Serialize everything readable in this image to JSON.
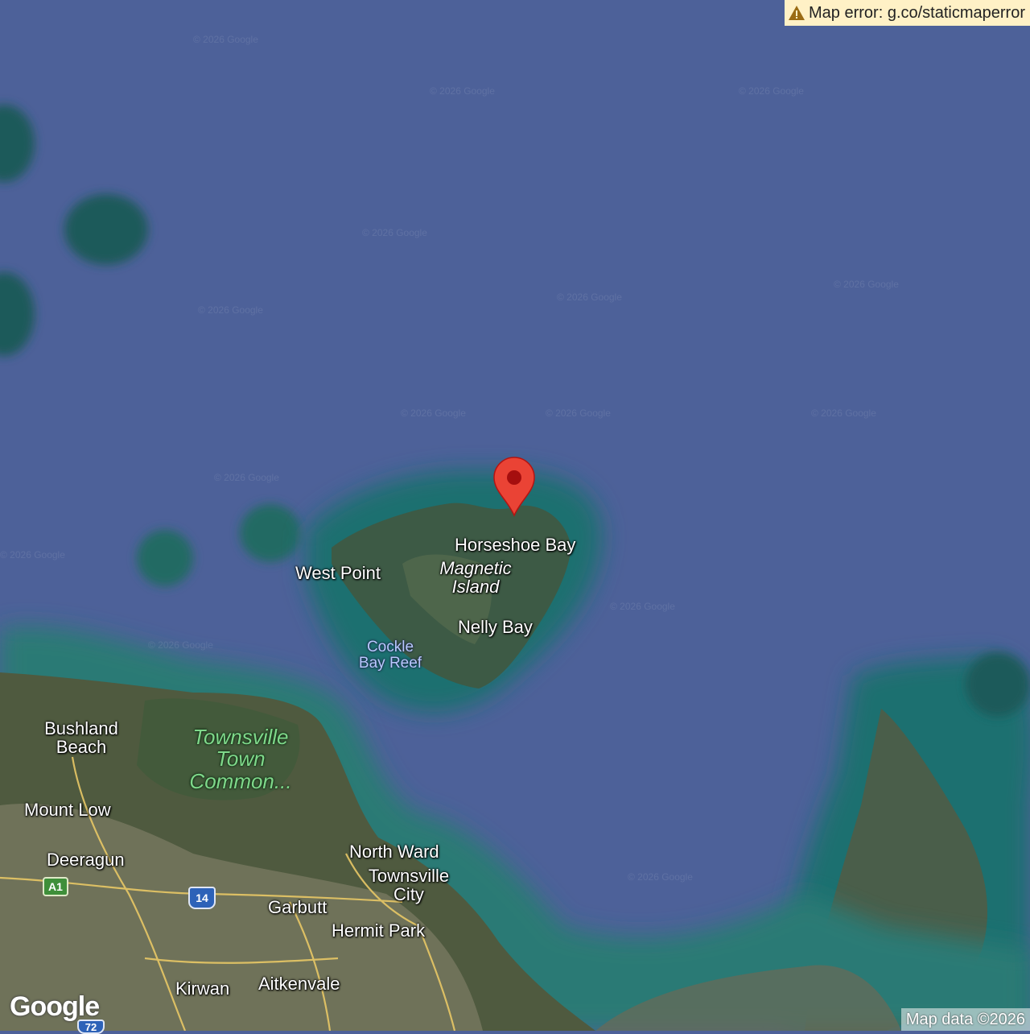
{
  "map": {
    "type": "satellite",
    "watermark": "© 2026 Google",
    "marker": {
      "color": "#ea4335",
      "name": "location-pin"
    },
    "error_banner": {
      "icon": "warning-icon",
      "text": "Map error: g.co/staticmaperror"
    },
    "attribution": "Map data ©2026",
    "logo_text": "Google",
    "labels": {
      "horseshoe_bay": "Horseshoe Bay",
      "magnetic_island_1": "Magnetic",
      "magnetic_island_2": "Island",
      "west_point": "West Point",
      "nelly_bay": "Nelly Bay",
      "cockle_bay_reef_1": "Cockle",
      "cockle_bay_reef_2": "Bay Reef",
      "bushland_beach_1": "Bushland",
      "bushland_beach_2": "Beach",
      "town_common_1": "Townsville",
      "town_common_2": "Town",
      "town_common_3": "Common...",
      "mount_low": "Mount Low",
      "deeragun": "Deeragun",
      "north_ward": "North Ward",
      "townsville_city_1": "Townsville",
      "townsville_city_2": "City",
      "garbutt": "Garbutt",
      "hermit_park": "Hermit Park",
      "kirwan": "Kirwan",
      "aitkenvale": "Aitkenvale"
    },
    "shields": {
      "a1": "A1",
      "r14": "14",
      "r72": "72"
    }
  }
}
